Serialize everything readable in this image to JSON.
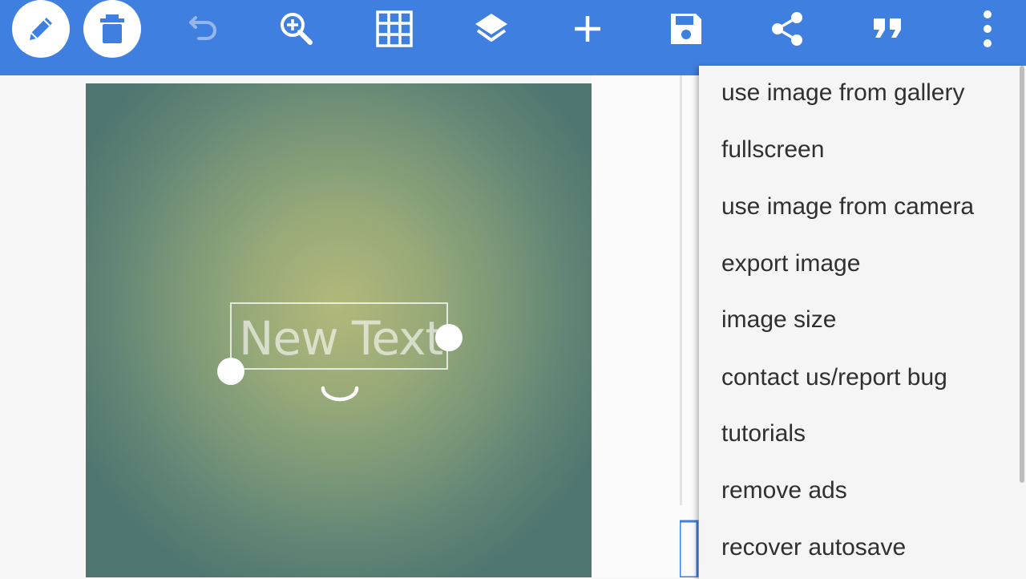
{
  "toolbar": {
    "color": "#3f7fe0",
    "icons": [
      "pencil-icon",
      "trash-icon",
      "undo-icon",
      "zoom-in-icon",
      "grid-icon",
      "layers-icon",
      "plus-icon",
      "save-icon",
      "share-icon",
      "quote-icon",
      "more-vertical-icon"
    ]
  },
  "canvas": {
    "text_layer": "New Text"
  },
  "menu": {
    "items": [
      "use image from gallery",
      "fullscreen",
      "use image from camera",
      "export image",
      "image size",
      "contact us/report bug",
      "tutorials",
      "remove ads",
      "recover autosave"
    ]
  }
}
